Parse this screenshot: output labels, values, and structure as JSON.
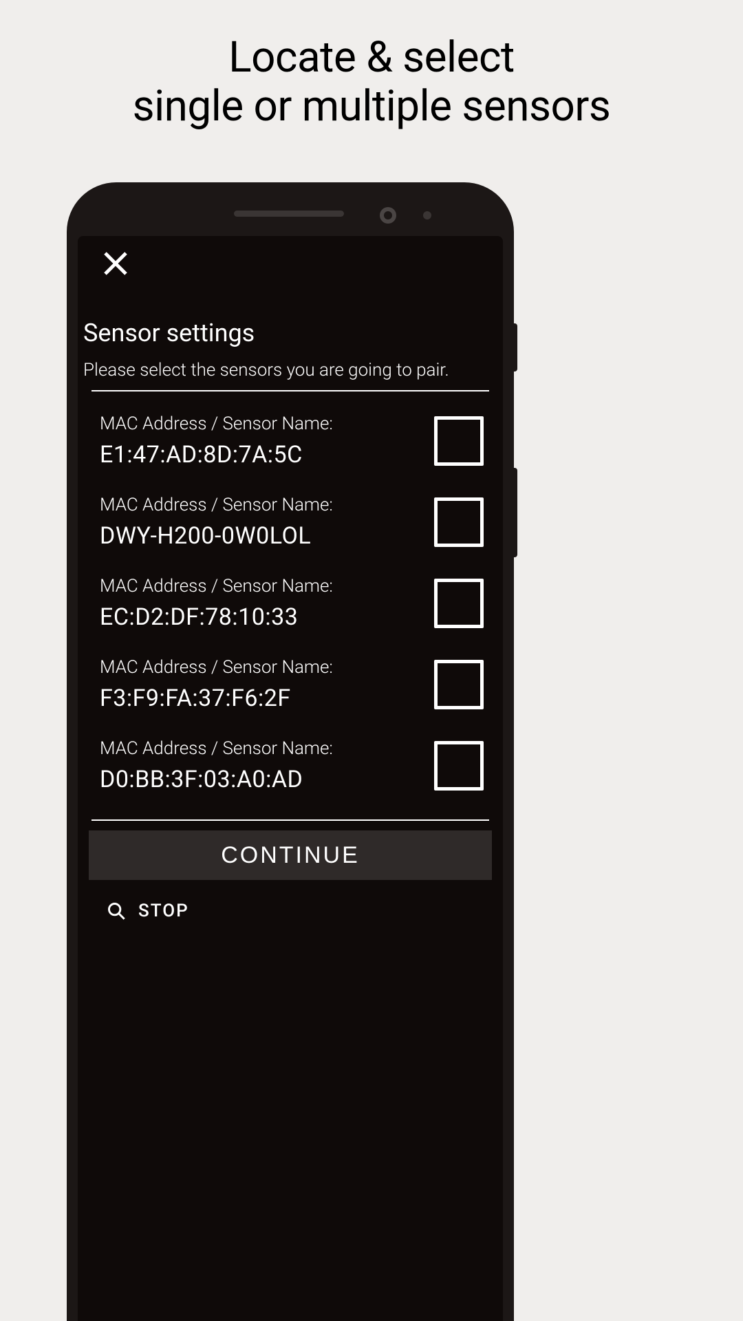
{
  "page": {
    "title_line1": "Locate & select",
    "title_line2": "single or multiple sensors"
  },
  "screen": {
    "heading": "Sensor settings",
    "subheading": "Please select the sensors you are going to pair.",
    "row_label": "MAC Address / Sensor Name:",
    "sensors": [
      {
        "value": "E1:47:AD:8D:7A:5C"
      },
      {
        "value": "DWY-H200-0W0LOL"
      },
      {
        "value": "EC:D2:DF:78:10:33"
      },
      {
        "value": "F3:F9:FA:37:F6:2F"
      },
      {
        "value": "D0:BB:3F:03:A0:AD"
      }
    ],
    "continue_label": "CONTINUE",
    "stop_label": "STOP"
  }
}
